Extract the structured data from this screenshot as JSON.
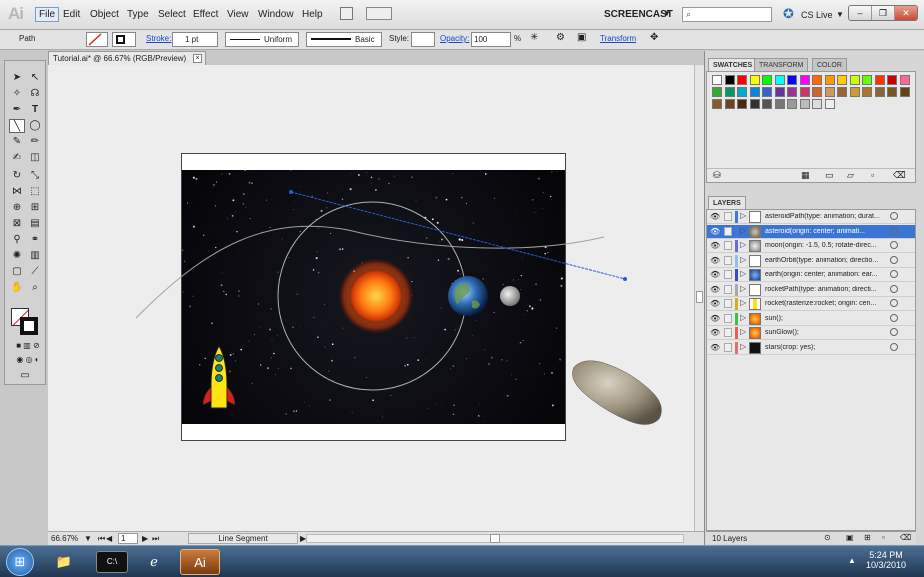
{
  "menubar": {
    "app_logo": "Ai",
    "menus": [
      "File",
      "Edit",
      "Object",
      "Type",
      "Select",
      "Effect",
      "View",
      "Window",
      "Help"
    ],
    "workspace": "SCREENCAST",
    "cs_live": "CS Live"
  },
  "control_bar": {
    "selection_type": "Path",
    "stroke_label": "Stroke:",
    "stroke_weight": "1 pt",
    "profile_uniform": "Uniform",
    "brush_basic": "Basic",
    "style_label": "Style:",
    "opacity_label": "Opacity:",
    "opacity_value": "100",
    "opacity_unit": "%",
    "transform_label": "Transform"
  },
  "document": {
    "tab_title": "Tutorial.ai* @ 66.67% (RGB/Preview)",
    "tab_close": "×"
  },
  "statusbar": {
    "zoom": "66.67%",
    "artboard_number": "1",
    "current_tool": "Line Segment"
  },
  "panels": {
    "tabs": [
      "SWATCHES",
      "TRANSFORM",
      "COLOR"
    ],
    "layers_title": "LAYERS",
    "layers_count": "10 Layers",
    "layers": [
      {
        "name": "asteroidPath(type: animation; durat...",
        "color": "#3c7ad8",
        "thumb": "path"
      },
      {
        "name": "asteroid(origin: center; animati...",
        "color": "#3c7ad8",
        "thumb": "asteroid",
        "selected": true
      },
      {
        "name": "moon(origin: -1.5, 0.5; rotate-direc...",
        "color": "#6a6ad8",
        "thumb": "moon"
      },
      {
        "name": "earthOrbit(type: animation; directio...",
        "color": "#8ec0e8",
        "thumb": "path"
      },
      {
        "name": "earth(origin: center; animation: ear...",
        "color": "#3c4ac8",
        "thumb": "earth"
      },
      {
        "name": "rocketPath(type: animation; directi...",
        "color": "#a8a8a8",
        "thumb": "path"
      },
      {
        "name": "rocket(rasterize:rocket; origin: cen...",
        "color": "#d0b020",
        "thumb": "rocket"
      },
      {
        "name": "sun();",
        "color": "#40c040",
        "thumb": "sun"
      },
      {
        "name": "sunGlow();",
        "color": "#e06060",
        "thumb": "sun"
      },
      {
        "name": "stars(crop: yes);",
        "color": "#e07070",
        "thumb": "stars"
      }
    ]
  },
  "swatch_colors": [
    "#ffffff",
    "#000000",
    "#ff0000",
    "#ffff00",
    "#00ff00",
    "#00ffff",
    "#0000ff",
    "#ff00ff",
    "#ff6a00",
    "#ff9900",
    "#ffcc00",
    "#ccff00",
    "#66ff00",
    "#ff3300",
    "#cc0000",
    "#ff6699",
    "#33aa33",
    "#009966",
    "#00aacc",
    "#0088dd",
    "#3366cc",
    "#663399",
    "#993399",
    "#cc3366",
    "#cc6633",
    "#cc9966",
    "#996633",
    "#cc9933",
    "#aa7733",
    "#886633",
    "#775522",
    "#664411",
    "#8b5a2b",
    "#6b4422",
    "#4a2a11",
    "#333333",
    "#555555",
    "#777777",
    "#999999",
    "#bbbbbb",
    "#dddddd",
    "#eeeeee"
  ],
  "taskbar": {
    "time": "5:24 PM",
    "date": "10/3/2010",
    "ai_label": "Ai"
  }
}
